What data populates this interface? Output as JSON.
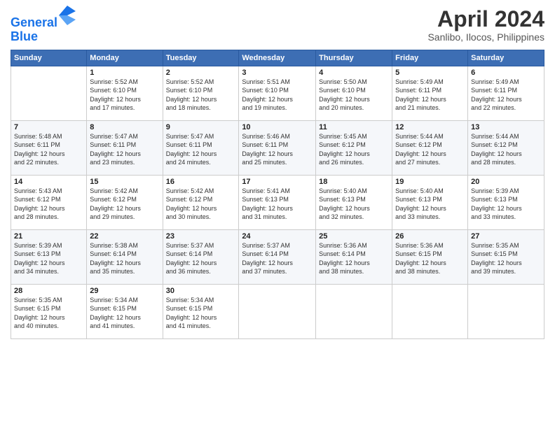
{
  "header": {
    "logo_line1": "General",
    "logo_line2": "Blue",
    "title": "April 2024",
    "location": "Sanlibo, Ilocos, Philippines"
  },
  "weekdays": [
    "Sunday",
    "Monday",
    "Tuesday",
    "Wednesday",
    "Thursday",
    "Friday",
    "Saturday"
  ],
  "weeks": [
    [
      {
        "day": "",
        "info": ""
      },
      {
        "day": "1",
        "info": "Sunrise: 5:52 AM\nSunset: 6:10 PM\nDaylight: 12 hours\nand 17 minutes."
      },
      {
        "day": "2",
        "info": "Sunrise: 5:52 AM\nSunset: 6:10 PM\nDaylight: 12 hours\nand 18 minutes."
      },
      {
        "day": "3",
        "info": "Sunrise: 5:51 AM\nSunset: 6:10 PM\nDaylight: 12 hours\nand 19 minutes."
      },
      {
        "day": "4",
        "info": "Sunrise: 5:50 AM\nSunset: 6:10 PM\nDaylight: 12 hours\nand 20 minutes."
      },
      {
        "day": "5",
        "info": "Sunrise: 5:49 AM\nSunset: 6:11 PM\nDaylight: 12 hours\nand 21 minutes."
      },
      {
        "day": "6",
        "info": "Sunrise: 5:49 AM\nSunset: 6:11 PM\nDaylight: 12 hours\nand 22 minutes."
      }
    ],
    [
      {
        "day": "7",
        "info": "Sunrise: 5:48 AM\nSunset: 6:11 PM\nDaylight: 12 hours\nand 22 minutes."
      },
      {
        "day": "8",
        "info": "Sunrise: 5:47 AM\nSunset: 6:11 PM\nDaylight: 12 hours\nand 23 minutes."
      },
      {
        "day": "9",
        "info": "Sunrise: 5:47 AM\nSunset: 6:11 PM\nDaylight: 12 hours\nand 24 minutes."
      },
      {
        "day": "10",
        "info": "Sunrise: 5:46 AM\nSunset: 6:11 PM\nDaylight: 12 hours\nand 25 minutes."
      },
      {
        "day": "11",
        "info": "Sunrise: 5:45 AM\nSunset: 6:12 PM\nDaylight: 12 hours\nand 26 minutes."
      },
      {
        "day": "12",
        "info": "Sunrise: 5:44 AM\nSunset: 6:12 PM\nDaylight: 12 hours\nand 27 minutes."
      },
      {
        "day": "13",
        "info": "Sunrise: 5:44 AM\nSunset: 6:12 PM\nDaylight: 12 hours\nand 28 minutes."
      }
    ],
    [
      {
        "day": "14",
        "info": "Sunrise: 5:43 AM\nSunset: 6:12 PM\nDaylight: 12 hours\nand 28 minutes."
      },
      {
        "day": "15",
        "info": "Sunrise: 5:42 AM\nSunset: 6:12 PM\nDaylight: 12 hours\nand 29 minutes."
      },
      {
        "day": "16",
        "info": "Sunrise: 5:42 AM\nSunset: 6:12 PM\nDaylight: 12 hours\nand 30 minutes."
      },
      {
        "day": "17",
        "info": "Sunrise: 5:41 AM\nSunset: 6:13 PM\nDaylight: 12 hours\nand 31 minutes."
      },
      {
        "day": "18",
        "info": "Sunrise: 5:40 AM\nSunset: 6:13 PM\nDaylight: 12 hours\nand 32 minutes."
      },
      {
        "day": "19",
        "info": "Sunrise: 5:40 AM\nSunset: 6:13 PM\nDaylight: 12 hours\nand 33 minutes."
      },
      {
        "day": "20",
        "info": "Sunrise: 5:39 AM\nSunset: 6:13 PM\nDaylight: 12 hours\nand 33 minutes."
      }
    ],
    [
      {
        "day": "21",
        "info": "Sunrise: 5:39 AM\nSunset: 6:13 PM\nDaylight: 12 hours\nand 34 minutes."
      },
      {
        "day": "22",
        "info": "Sunrise: 5:38 AM\nSunset: 6:14 PM\nDaylight: 12 hours\nand 35 minutes."
      },
      {
        "day": "23",
        "info": "Sunrise: 5:37 AM\nSunset: 6:14 PM\nDaylight: 12 hours\nand 36 minutes."
      },
      {
        "day": "24",
        "info": "Sunrise: 5:37 AM\nSunset: 6:14 PM\nDaylight: 12 hours\nand 37 minutes."
      },
      {
        "day": "25",
        "info": "Sunrise: 5:36 AM\nSunset: 6:14 PM\nDaylight: 12 hours\nand 38 minutes."
      },
      {
        "day": "26",
        "info": "Sunrise: 5:36 AM\nSunset: 6:15 PM\nDaylight: 12 hours\nand 38 minutes."
      },
      {
        "day": "27",
        "info": "Sunrise: 5:35 AM\nSunset: 6:15 PM\nDaylight: 12 hours\nand 39 minutes."
      }
    ],
    [
      {
        "day": "28",
        "info": "Sunrise: 5:35 AM\nSunset: 6:15 PM\nDaylight: 12 hours\nand 40 minutes."
      },
      {
        "day": "29",
        "info": "Sunrise: 5:34 AM\nSunset: 6:15 PM\nDaylight: 12 hours\nand 41 minutes."
      },
      {
        "day": "30",
        "info": "Sunrise: 5:34 AM\nSunset: 6:15 PM\nDaylight: 12 hours\nand 41 minutes."
      },
      {
        "day": "",
        "info": ""
      },
      {
        "day": "",
        "info": ""
      },
      {
        "day": "",
        "info": ""
      },
      {
        "day": "",
        "info": ""
      }
    ]
  ]
}
